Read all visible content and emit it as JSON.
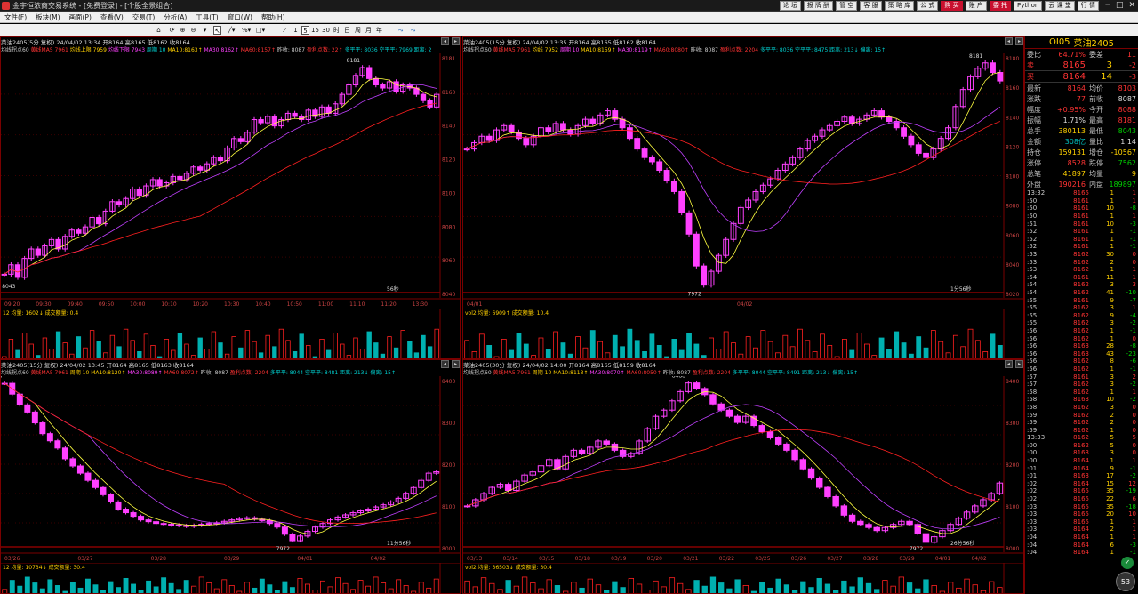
{
  "title": "金宇恒浓商交易系统 - [免费登录] - [个股全景组合]",
  "top_buttons": [
    {
      "label": "论 坛",
      "red": false
    },
    {
      "label": "报 牌 酬",
      "red": false
    },
    {
      "label": "管 空",
      "red": false
    },
    {
      "label": "客 服",
      "red": false
    },
    {
      "label": "策 略 库",
      "red": false
    },
    {
      "label": "公 式",
      "red": false
    },
    {
      "label": "购 买",
      "red": true
    },
    {
      "label": "账 户",
      "red": false
    },
    {
      "label": "委 托",
      "red": true
    },
    {
      "label": "Python",
      "red": false
    },
    {
      "label": "云 课 堂",
      "red": false
    },
    {
      "label": "行 情",
      "red": false
    }
  ],
  "menu": [
    "文件(F)",
    "板块(M)",
    "画面(P)",
    "查看(V)",
    "交易(T)",
    "分析(A)",
    "工具(T)",
    "窗口(W)",
    "帮助(H)"
  ],
  "toolbar": {
    "p1": "1",
    "p5": "5",
    "p15": "15",
    "p30": "30",
    "h": "时",
    "d": "日",
    "w": "周",
    "mo": "月",
    "y": "年"
  },
  "panels": [
    {
      "header": "菜油2405(5分 复权) 24/04/02 13:34 开8164 高8165 低8162 收8164",
      "info": [
        {
          "c": "w",
          "t": "均线拐点60 "
        },
        {
          "c": "r",
          "t": "黄线MA5 7961 "
        },
        {
          "c": "y",
          "t": "均线上限 7959 "
        },
        {
          "c": "m",
          "t": "均线下限 7943 "
        },
        {
          "c": "g",
          "t": "周期 10 "
        },
        {
          "c": "y",
          "t": "MA10:8163↑ "
        },
        {
          "c": "m",
          "t": "MA30:8162↑ "
        },
        {
          "c": "r",
          "t": "MA60:8157↑ "
        },
        {
          "c": "w",
          "t": "昨收: 8087 "
        },
        {
          "c": "r",
          "t": "盈利点数: 22↑ "
        },
        {
          "c": "g",
          "t": "多平平: 8036 空平平: 7969 距离: 2"
        }
      ],
      "max_label": "8181",
      "min_label": "8043",
      "timer": "56秒",
      "axis": [
        "8181",
        "8160",
        "8140",
        "8120",
        "8100",
        "8080",
        "8060",
        "8040"
      ],
      "x_labels": [
        "09:20",
        "09:30",
        "09:40",
        "09:50",
        "10:00",
        "10:10",
        "10:20",
        "10:30",
        "10:40",
        "10:50",
        "11:00",
        "11:10",
        "11:20",
        "13:30"
      ],
      "vol_info": "12 均量: 1602↓ 成交额量: 0.4"
    },
    {
      "header": "菜油2405(15分 复权) 24/04/02 13:35 开8164 高8165 低8162 收8164",
      "info": [
        {
          "c": "w",
          "t": "均线拐点60 "
        },
        {
          "c": "r",
          "t": "黄线MA5 7961 "
        },
        {
          "c": "y",
          "t": "均线 7952 "
        },
        {
          "c": "m",
          "t": "周期 10 "
        },
        {
          "c": "y",
          "t": "MA10:8159↑ "
        },
        {
          "c": "m",
          "t": "MA30:8119↑ "
        },
        {
          "c": "r",
          "t": "MA60:8080↑ "
        },
        {
          "c": "w",
          "t": "昨收: 8087 "
        },
        {
          "c": "r",
          "t": "盈利点数: 2204 "
        },
        {
          "c": "g",
          "t": "多平平: 8036 空平平: 8475 距离: 213↓ 偏离: 15↑"
        }
      ],
      "max_label": "8181",
      "min_label": "7972",
      "timer": "1分56秒",
      "axis": [
        "8180",
        "8160",
        "8140",
        "8120",
        "8100",
        "8080",
        "8060",
        "8040",
        "8020"
      ],
      "x_labels": [
        "04/01",
        "04/02"
      ],
      "vol_info": "vol2 均量: 6909↑ 成交额量: 10.4"
    },
    {
      "header": "菜油2405(15分 复权) 24/04/02 13:45 开8164 高8165 低8163 收8164",
      "info": [
        {
          "c": "w",
          "t": "均线拐点60 "
        },
        {
          "c": "r",
          "t": "黄线MA5 7961 "
        },
        {
          "c": "y",
          "t": "周期 10 "
        },
        {
          "c": "y",
          "t": "MA10:8120↑ "
        },
        {
          "c": "m",
          "t": "MA30:8089↑ "
        },
        {
          "c": "r",
          "t": "MA60:8072↑ "
        },
        {
          "c": "w",
          "t": "昨收: 8087 "
        },
        {
          "c": "r",
          "t": "盈利点数: 2204 "
        },
        {
          "c": "g",
          "t": "多平平: 8044 空平平: 8481 距离: 213↓ 偏离: 15↑"
        }
      ],
      "max_label": "8410",
      "min_label": "7972",
      "timer": "11分56秒",
      "axis": [
        "8400",
        "8300",
        "8200",
        "8100",
        "8000"
      ],
      "x_labels": [
        "03/26",
        "03/27",
        "03/28",
        "03/29",
        "04/01",
        "04/02"
      ],
      "vol_info": "12 均量: 10734↓ 成交额量: 30.4"
    },
    {
      "header": "菜油2405(30分 复权) 24/04/02 14:00 开8164 高8165 低8159 收8164",
      "info": [
        {
          "c": "w",
          "t": "均线拐点60 "
        },
        {
          "c": "r",
          "t": "黄线MA5 7961 "
        },
        {
          "c": "y",
          "t": "周期 10 "
        },
        {
          "c": "y",
          "t": "MA10:8113↑ "
        },
        {
          "c": "m",
          "t": "MA30:8070↑ "
        },
        {
          "c": "r",
          "t": "MA60:8050↑ "
        },
        {
          "c": "w",
          "t": "昨收: 8087 "
        },
        {
          "c": "r",
          "t": "盈利点数: 2204 "
        },
        {
          "c": "g",
          "t": "多平平: 8044 空平平: 8491 距离: 213↓ 偏离: 15↑"
        }
      ],
      "max_label": "8488",
      "min_label": "7972",
      "timer": "26分56秒",
      "axis": [
        "8400",
        "8300",
        "8200",
        "8100",
        "8000"
      ],
      "x_labels": [
        "03/13",
        "03/14",
        "03/15",
        "03/18",
        "03/19",
        "03/20",
        "03/21",
        "03/22",
        "03/25",
        "03/26",
        "03/27",
        "03/28",
        "03/29",
        "04/01",
        "04/02"
      ],
      "vol_info": "vol2 均量: 36503↓ 成交额量: 30.4"
    }
  ],
  "quote": {
    "code": "OI05",
    "name": "菜油2405",
    "ratio": {
      "l1": "委比",
      "v1": "64.71%",
      "l2": "委差",
      "v2": "11"
    },
    "sell": {
      "label": "卖",
      "price": "8165",
      "qty": "3",
      "chg": "-2"
    },
    "buy": {
      "label": "买",
      "price": "8164",
      "qty": "14",
      "chg": "-3"
    },
    "rows": [
      {
        "l1": "最新",
        "v1": "8164",
        "c1": "up",
        "l2": "均价",
        "v2": "8103",
        "c2": "up"
      },
      {
        "l1": "涨跌",
        "v1": "77",
        "c1": "up",
        "l2": "前收",
        "v2": "8087",
        "c2": "wt"
      },
      {
        "l1": "幅度",
        "v1": "+0.95%",
        "c1": "up",
        "l2": "今开",
        "v2": "8088",
        "c2": "up"
      },
      {
        "l1": "振幅",
        "v1": "1.71%",
        "c1": "wt",
        "l2": "最高",
        "v2": "8181",
        "c2": "up"
      },
      {
        "l1": "总手",
        "v1": "380113",
        "c1": "yl",
        "l2": "最低",
        "v2": "8043",
        "c2": "dn"
      },
      {
        "l1": "金额",
        "v1": "308亿",
        "c1": "cy",
        "l2": "量比",
        "v2": "1.14",
        "c2": "wt"
      },
      {
        "l1": "持仓",
        "v1": "159131",
        "c1": "yl",
        "l2": "增仓",
        "v2": "-10567",
        "c2": "yl"
      },
      {
        "l1": "涨停",
        "v1": "8528",
        "c1": "up",
        "l2": "跌停",
        "v2": "7562",
        "c2": "dn"
      },
      {
        "l1": "总笔",
        "v1": "41897",
        "c1": "yl",
        "l2": "均量",
        "v2": "9",
        "c2": "yl"
      },
      {
        "l1": "外盘",
        "v1": "190216",
        "c1": "up",
        "l2": "内盘",
        "v2": "189897",
        "c2": "dn"
      }
    ],
    "ticks": [
      {
        "t": "13:32",
        "p": "8165",
        "v": "1",
        "c": "1"
      },
      {
        "t": ":50",
        "p": "8161",
        "v": "1",
        "c": "1"
      },
      {
        "t": ":50",
        "p": "8161",
        "v": "10",
        "c": "-8"
      },
      {
        "t": ":50",
        "p": "8161",
        "v": "1",
        "c": "1"
      },
      {
        "t": ":51",
        "p": "8161",
        "v": "10",
        "c": "-3"
      },
      {
        "t": ":52",
        "p": "8161",
        "v": "1",
        "c": "-1"
      },
      {
        "t": ":52",
        "p": "8161",
        "v": "1",
        "c": "-1"
      },
      {
        "t": ":52",
        "p": "8161",
        "v": "1",
        "c": "-1"
      },
      {
        "t": ":53",
        "p": "8162",
        "v": "30",
        "c": "0"
      },
      {
        "t": ":53",
        "p": "8162",
        "v": "2",
        "c": "0"
      },
      {
        "t": ":53",
        "p": "8162",
        "v": "1",
        "c": "1"
      },
      {
        "t": ":54",
        "p": "8161",
        "v": "11",
        "c": "1"
      },
      {
        "t": ":54",
        "p": "8162",
        "v": "3",
        "c": "3"
      },
      {
        "t": ":54",
        "p": "8162",
        "v": "41",
        "c": "-10"
      },
      {
        "t": ":55",
        "p": "8161",
        "v": "9",
        "c": "-7"
      },
      {
        "t": ":55",
        "p": "8162",
        "v": "3",
        "c": "1"
      },
      {
        "t": ":55",
        "p": "8162",
        "v": "9",
        "c": "-4"
      },
      {
        "t": ":55",
        "p": "8162",
        "v": "3",
        "c": "-2"
      },
      {
        "t": ":56",
        "p": "8162",
        "v": "1",
        "c": "-1"
      },
      {
        "t": ":56",
        "p": "8162",
        "v": "1",
        "c": "0"
      },
      {
        "t": ":56",
        "p": "8163",
        "v": "28",
        "c": "-8"
      },
      {
        "t": ":56",
        "p": "8163",
        "v": "43",
        "c": "-23"
      },
      {
        "t": ":56",
        "p": "8162",
        "v": "8",
        "c": "-6"
      },
      {
        "t": ":56",
        "p": "8162",
        "v": "1",
        "c": "-1"
      },
      {
        "t": ":57",
        "p": "8161",
        "v": "3",
        "c": "2"
      },
      {
        "t": ":57",
        "p": "8162",
        "v": "3",
        "c": "-2"
      },
      {
        "t": ":58",
        "p": "8162",
        "v": "1",
        "c": "1"
      },
      {
        "t": ":58",
        "p": "8163",
        "v": "10",
        "c": "-2"
      },
      {
        "t": ":58",
        "p": "8162",
        "v": "3",
        "c": "0"
      },
      {
        "t": ":59",
        "p": "8162",
        "v": "2",
        "c": "0"
      },
      {
        "t": ":59",
        "p": "8162",
        "v": "2",
        "c": "0"
      },
      {
        "t": ":59",
        "p": "8162",
        "v": "1",
        "c": "0"
      },
      {
        "t": "13:33",
        "p": "8162",
        "v": "5",
        "c": "5"
      },
      {
        "t": ":00",
        "p": "8162",
        "v": "5",
        "c": "0"
      },
      {
        "t": ":00",
        "p": "8163",
        "v": "3",
        "c": "0"
      },
      {
        "t": ":00",
        "p": "8164",
        "v": "1",
        "c": "1"
      },
      {
        "t": ":01",
        "p": "8164",
        "v": "9",
        "c": "-1"
      },
      {
        "t": ":01",
        "p": "8163",
        "v": "17",
        "c": "-2"
      },
      {
        "t": ":02",
        "p": "8164",
        "v": "15",
        "c": "12"
      },
      {
        "t": ":02",
        "p": "8165",
        "v": "35",
        "c": "-19"
      },
      {
        "t": ":02",
        "p": "8165",
        "v": "22",
        "c": "6"
      },
      {
        "t": ":03",
        "p": "8165",
        "v": "35",
        "c": "-18"
      },
      {
        "t": ":03",
        "p": "8165",
        "v": "20",
        "c": "10"
      },
      {
        "t": ":03",
        "p": "8165",
        "v": "1",
        "c": "1"
      },
      {
        "t": ":03",
        "p": "8164",
        "v": "2",
        "c": "1"
      },
      {
        "t": ":04",
        "p": "8164",
        "v": "1",
        "c": "1"
      },
      {
        "t": ":04",
        "p": "8164",
        "v": "6",
        "c": "-3"
      },
      {
        "t": ":04",
        "p": "8164",
        "v": "1",
        "c": "-1"
      }
    ],
    "badge": "53"
  },
  "chart_data": [
    {
      "type": "candlestick",
      "title": "菜油2405(5分 复权)",
      "ylim": [
        8035,
        8190
      ],
      "close": [
        8050,
        8056,
        8048,
        8060,
        8066,
        8062,
        8068,
        8072,
        8066,
        8074,
        8078,
        8076,
        8080,
        8086,
        8082,
        8090,
        8096,
        8094,
        8098,
        8104,
        8100,
        8106,
        8110,
        8106,
        8108,
        8112,
        8110,
        8114,
        8118,
        8116,
        8120,
        8124,
        8122,
        8130,
        8136,
        8134,
        8140,
        8148,
        8146,
        8150,
        8144,
        8148,
        8152,
        8150,
        8148,
        8154,
        8150,
        8156,
        8152,
        8158,
        8164,
        8170,
        8176,
        8181,
        8174,
        8170,
        8168,
        8172,
        8166,
        8170,
        8168,
        8164,
        8160,
        8156,
        8164
      ]
    },
    {
      "type": "candlestick",
      "title": "菜油2405(15分 复权)",
      "ylim": [
        7960,
        8190
      ],
      "close": [
        8100,
        8106,
        8112,
        8108,
        8118,
        8122,
        8116,
        8110,
        8104,
        8112,
        8120,
        8116,
        8124,
        8118,
        8114,
        8122,
        8128,
        8124,
        8132,
        8136,
        8128,
        8120,
        8110,
        8100,
        8092,
        8088,
        8080,
        8070,
        8060,
        8040,
        8020,
        7990,
        7972,
        7985,
        8000,
        8015,
        8030,
        8045,
        8052,
        8060,
        8066,
        8072,
        8080,
        8086,
        8092,
        8100,
        8108,
        8112,
        8118,
        8122,
        8126,
        8130,
        8124,
        8128,
        8132,
        8136,
        8130,
        8126,
        8120,
        8112,
        8104,
        8096,
        8092,
        8100,
        8110,
        8120,
        8140,
        8156,
        8168,
        8176,
        8181,
        8172,
        8164
      ]
    },
    {
      "type": "candlestick",
      "title": "菜油2405(15分 复权)",
      "ylim": [
        7940,
        8430
      ],
      "close": [
        8410,
        8380,
        8350,
        8330,
        8300,
        8270,
        8250,
        8230,
        8200,
        8180,
        8160,
        8140,
        8120,
        8100,
        8080,
        8060,
        8050,
        8040,
        8030,
        8025,
        8020,
        8018,
        8016,
        8014,
        8012,
        8015,
        8018,
        8020,
        8022,
        8026,
        8030,
        8034,
        8036,
        8032,
        8028,
        8020,
        8010,
        7990,
        7972,
        7985,
        7998,
        8010,
        8020,
        8030,
        8038,
        8044,
        8050,
        8055,
        8060,
        8066,
        8072,
        8080,
        8090,
        8104,
        8120,
        8140,
        8160,
        8164
      ]
    },
    {
      "type": "candlestick",
      "title": "菜油2405(30分 复权)",
      "ylim": [
        7940,
        8510
      ],
      "close": [
        8090,
        8110,
        8130,
        8150,
        8160,
        8140,
        8170,
        8190,
        8200,
        8220,
        8240,
        8210,
        8250,
        8270,
        8260,
        8280,
        8300,
        8290,
        8270,
        8250,
        8260,
        8300,
        8340,
        8380,
        8400,
        8430,
        8460,
        8488,
        8470,
        8450,
        8420,
        8400,
        8380,
        8360,
        8380,
        8350,
        8330,
        8310,
        8290,
        8270,
        8240,
        8210,
        8180,
        8150,
        8120,
        8090,
        8060,
        8040,
        8030,
        8020,
        8010,
        8020,
        8030,
        8040,
        8030,
        8000,
        7972,
        7990,
        8010,
        8030,
        8050,
        8070,
        8090,
        8110,
        8130,
        8164
      ]
    }
  ]
}
